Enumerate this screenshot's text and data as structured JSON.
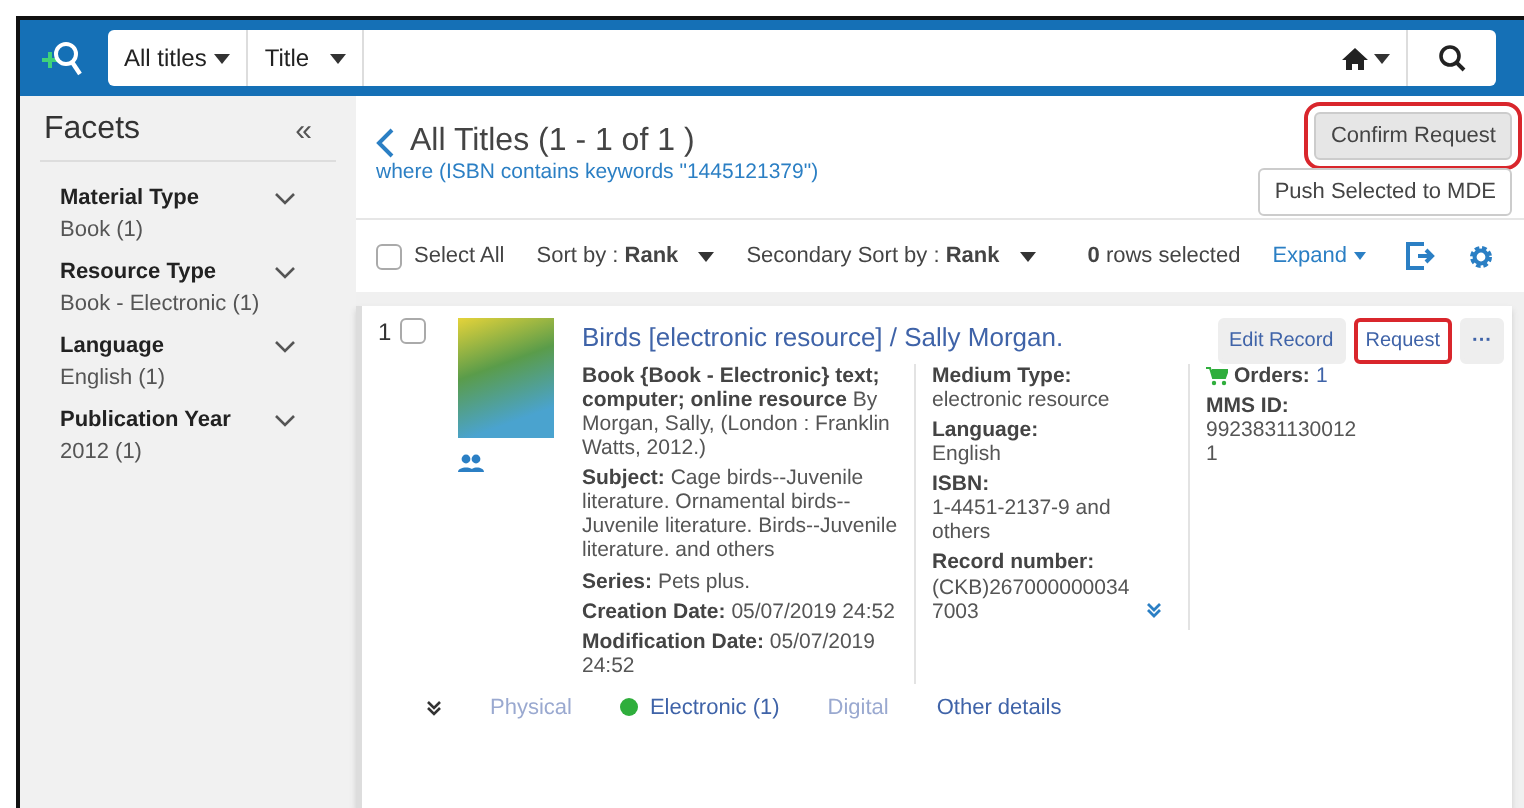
{
  "search_bar": {
    "scope": "All titles",
    "field": "Title"
  },
  "facets": {
    "title": "Facets",
    "collapse": "«",
    "groups": [
      {
        "name": "Material Type",
        "values": [
          "Book (1)"
        ]
      },
      {
        "name": "Resource Type",
        "values": [
          "Book - Electronic (1)"
        ]
      },
      {
        "name": "Language",
        "values": [
          "English (1)"
        ]
      },
      {
        "name": "Publication Year",
        "values": [
          "2012 (1)"
        ]
      }
    ]
  },
  "results_header": {
    "title": "All Titles (1 - 1 of 1 )",
    "query": "where (ISBN contains keywords \"1445121379\")",
    "buttons": [
      {
        "label": "Confirm Request",
        "highlighted": true
      },
      {
        "label": "Push Selected to MDE",
        "highlighted": false
      }
    ]
  },
  "toolbar": {
    "select_all": {
      "label": "Select All",
      "checked": false
    },
    "sort": {
      "label": "Sort by :",
      "value": "Rank"
    },
    "secondary_sort": {
      "label": "Secondary Sort by :",
      "value": "Rank"
    },
    "rows_selected_count": "0",
    "rows_selected_label": "rows selected",
    "expand": "Expand"
  },
  "results": [
    {
      "number": "1",
      "checked": false,
      "title": "Birds [electronic resource] / Sally Morgan.",
      "description": "**Book {Book - Electronic} text; computer; online resource** By Morgan, Sally, (London : Franklin Watts, 2012.)",
      "fields_left": [
        {
          "label": "Subject:",
          "value": "Cage birds--Juvenile literature. Ornamental birds--Juvenile literature. Birds--Juvenile literature. and others"
        },
        {
          "label": "Series:",
          "value": "Pets plus."
        },
        {
          "label": "Creation Date:",
          "value": "05/07/2019 24:52"
        },
        {
          "label": "Modification Date:",
          "value": "05/07/2019 24:52"
        }
      ],
      "fields_middle": [
        {
          "label": "Medium Type:",
          "value": "electronic resource"
        },
        {
          "label": "Language:",
          "value": "English"
        },
        {
          "label": "ISBN:",
          "value": "1-4451-2137-9 and others"
        },
        {
          "label": "Record number:",
          "value": "(CKB)2670000000347003"
        }
      ],
      "orders": {
        "label": "Orders:",
        "value": "1"
      },
      "mms_id": {
        "label": "MMS ID:",
        "value": "99238311300121"
      },
      "actions": [
        {
          "label": "Edit Record",
          "highlighted": false
        },
        {
          "label": "Request",
          "highlighted": true
        }
      ],
      "more": "···",
      "tabs": [
        {
          "label": "Physical",
          "available": false,
          "indicator": false
        },
        {
          "label": "Electronic (1)",
          "available": true,
          "indicator": true
        },
        {
          "label": "Digital",
          "available": false,
          "indicator": false
        },
        {
          "label": "Other details",
          "available": true,
          "indicator": false
        }
      ]
    }
  ]
}
